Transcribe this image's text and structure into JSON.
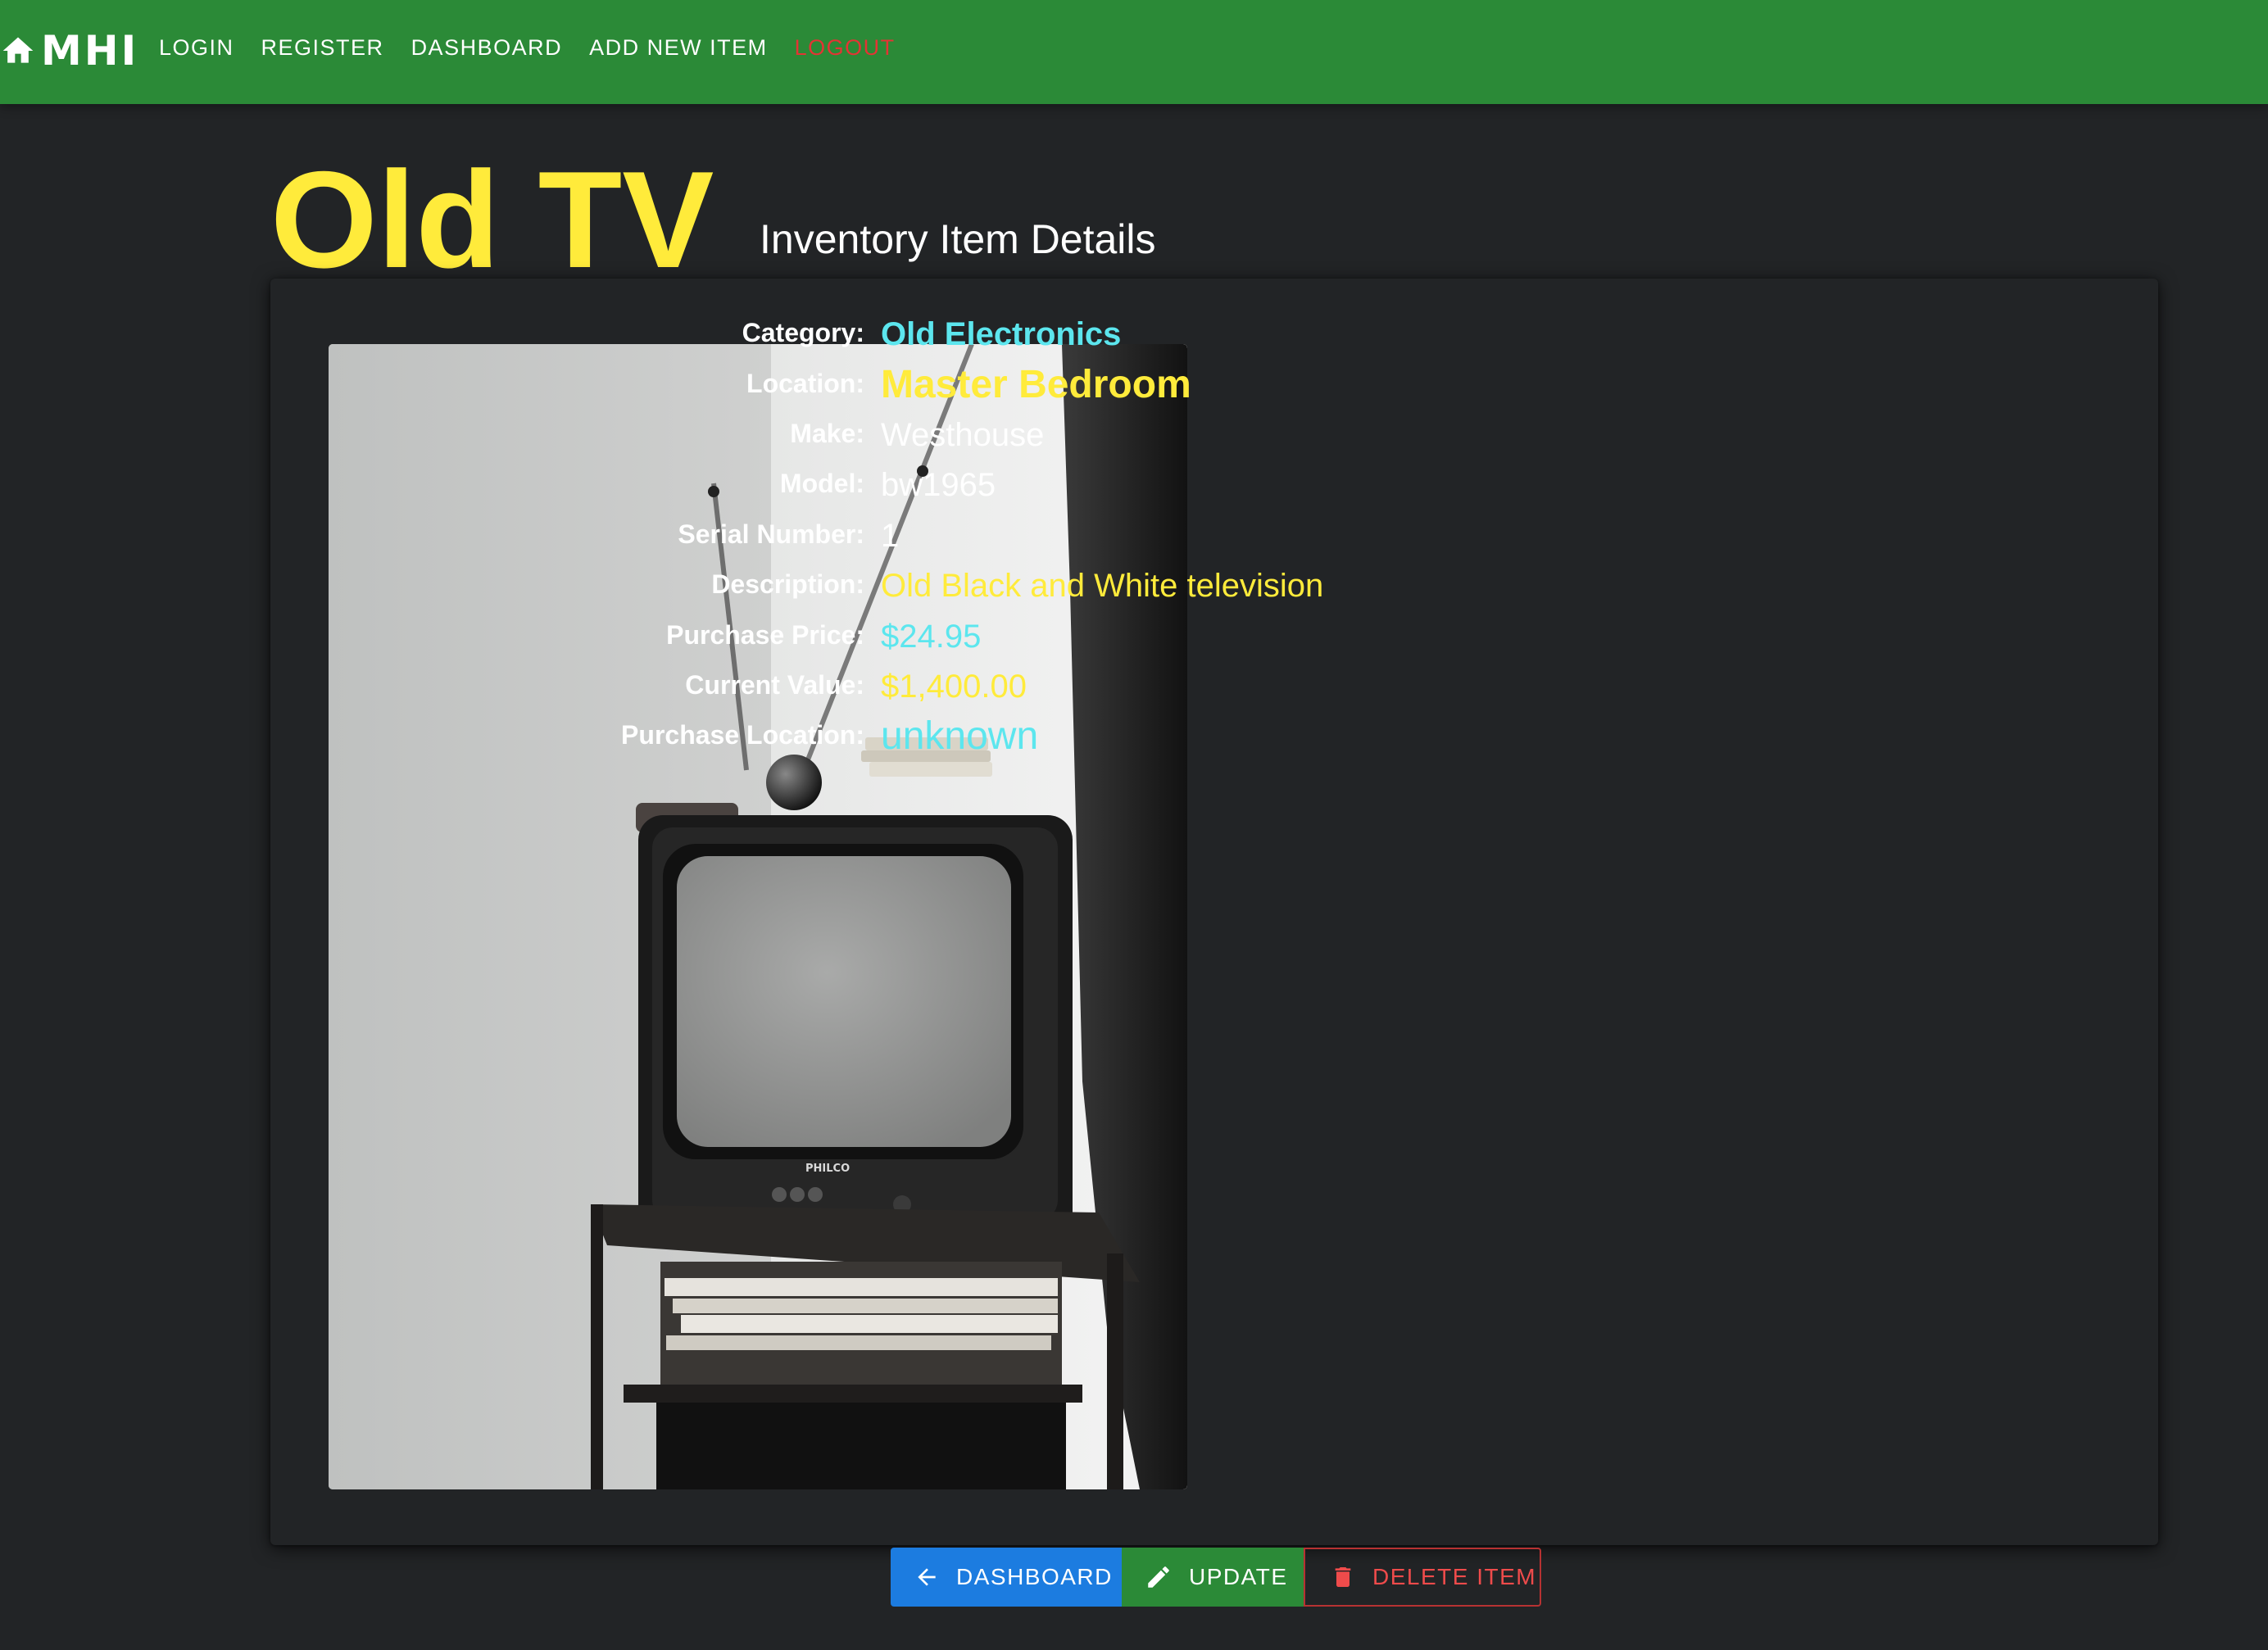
{
  "nav": {
    "brand": "MHI",
    "links": [
      "LOGIN",
      "REGISTER",
      "DASHBOARD",
      "ADD NEW ITEM",
      "LOGOUT"
    ]
  },
  "item": {
    "title": "Old TV",
    "subtitle": "Inventory Item Details",
    "photo_brand_text": "PHILCO"
  },
  "details": [
    {
      "label": "Category:",
      "value": "Old Electronics",
      "color": "#5ce6ee"
    },
    {
      "label": "Location:",
      "value": "Master Bedroom",
      "color": "#ffeb3b"
    },
    {
      "label": "Make:",
      "value": "Westhouse",
      "color": "#ffffff"
    },
    {
      "label": "Model:",
      "value": "bw1965",
      "color": "#ffffff"
    },
    {
      "label": "Serial Number:",
      "value": "1",
      "color": "#ffffff"
    },
    {
      "label": "Description:",
      "value": "Old Black and White television",
      "color": "#ffeb3b"
    },
    {
      "label": "Purchase Price:",
      "value": "$24.95",
      "color": "#5ce6ee"
    },
    {
      "label": "Current Value:",
      "value": "$1,400.00",
      "color": "#ffeb3b"
    },
    {
      "label": "Purchase Location:",
      "value": "unknown",
      "color": "#5ce6ee"
    }
  ],
  "buttons": {
    "dashboard": "DASHBOARD",
    "update": "UPDATE",
    "delete": "DELETE ITEM"
  },
  "colors": {
    "nav_bg": "#2b8a37",
    "page_bg": "#222426",
    "title": "#ffeb3b",
    "accent_cyan": "#5ce6ee",
    "accent_yellow": "#ffeb3b",
    "logout": "#e33434",
    "dashboard_btn": "#1c7ce0",
    "update_btn": "#2b8a37",
    "delete_btn": "#ef4b4b"
  }
}
